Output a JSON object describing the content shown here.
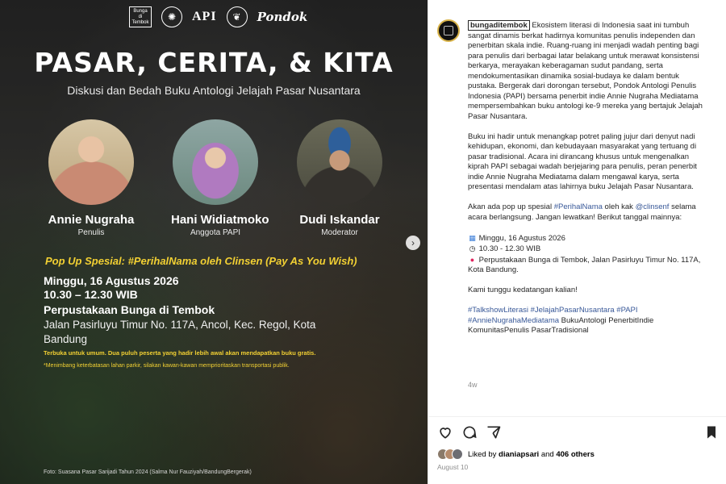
{
  "poster": {
    "logos": {
      "left_box": "Bunga di Tembok",
      "api": "API",
      "pondok": "Pondok"
    },
    "title": "PASAR, CERITA, & KITA",
    "subtitle": "Diskusi dan Bedah Buku Antologi Jelajah Pasar Nusantara",
    "speakers": [
      {
        "name": "Annie Nugraha",
        "role": "Penulis"
      },
      {
        "name": "Hani Widiatmoko",
        "role": "Anggota PAPI"
      },
      {
        "name": "Dudi Iskandar",
        "role": "Moderator"
      }
    ],
    "popup": "Pop Up Spesial:  #PerihalNama oleh Clinsen  (Pay As You Wish)",
    "date": "Minggu, 16 Agustus 2026",
    "time": "10.30 – 12.30 WIB",
    "venue": "Perpustakaan Bunga di Tembok",
    "address": "Jalan Pasirluyu Timur No. 117A, Ancol, Kec. Regol, Kota Bandung",
    "note1": "Terbuka untuk umum. Dua puluh peserta yang hadir lebih awal akan mendapatkan buku gratis.",
    "note2": "*Menimbang keterbatasan lahan parkir, silakan kawan-kawan memprioritaskan transportasi publik.",
    "credit": "Foto:  Suasana Pasar Sarijadi Tahun 2024 (Salma Nur Fauziyah/BandungBergerak)"
  },
  "post": {
    "username": "bungaditembok",
    "p1": "Ekosistem literasi di Indonesia saat ini tumbuh sangat dinamis berkat hadirnya komunitas penulis independen dan penerbitan skala indie. Ruang-ruang ini menjadi wadah penting bagi para penulis dari berbagai latar belakang untuk merawat konsistensi berkarya, merayakan keberagaman sudut pandang, serta mendokumentasikan dinamika sosial-budaya ke dalam bentuk pustaka. Bergerak dari dorongan tersebut, Pondok Antologi Penulis Indonesia (PAPI) bersama penerbit indie Annie Nugraha Mediatama mempersembahkan buku antologi ke-9 mereka yang bertajuk Jelajah Pasar Nusantara.",
    "p2": "Buku ini hadir untuk menangkap potret paling jujur dari denyut nadi kehidupan, ekonomi, dan kebudayaan masyarakat yang tertuang di pasar tradisional. Acara ini dirancang khusus untuk mengenalkan kiprah PAPI sebagai wadah berjejaring para penulis, peran penerbit indie Annie Nugraha Mediatama dalam mengawal karya, serta presentasi mendalam atas lahirnya buku Jelajah Pasar Nusantara.",
    "p3a": "Akan ada pop up spesial ",
    "p3tag": "#PerihalNama",
    "p3b": " oleh kak ",
    "p3mention": "@clinsenf",
    "p3c": " selama acara berlangsung. Jangan lewatkan! Berikut tanggal mainnya:",
    "d1": "Minggu, 16 Agustus 2026",
    "d2": "10.30 - 12.30 WIB",
    "d3": "Perpustakaan Bunga di Tembok, Jalan Pasirluyu Timur No. 117A, Kota Bandung.",
    "closing": "Kami tunggu kedatangan kalian!",
    "tags": "#TalkshowLiterasi #JelajahPasarNusantara #PAPI #AnnieNugrahaMediatama",
    "tags_plain": " BukuAntologi PenerbitIndie KomunitasPenulis PasarTradisional",
    "ago": "4w",
    "likes_prefix": "Liked by ",
    "likes_user": "dianiapsari",
    "likes_mid": " and ",
    "likes_count": "406 others",
    "date": "August 10"
  }
}
